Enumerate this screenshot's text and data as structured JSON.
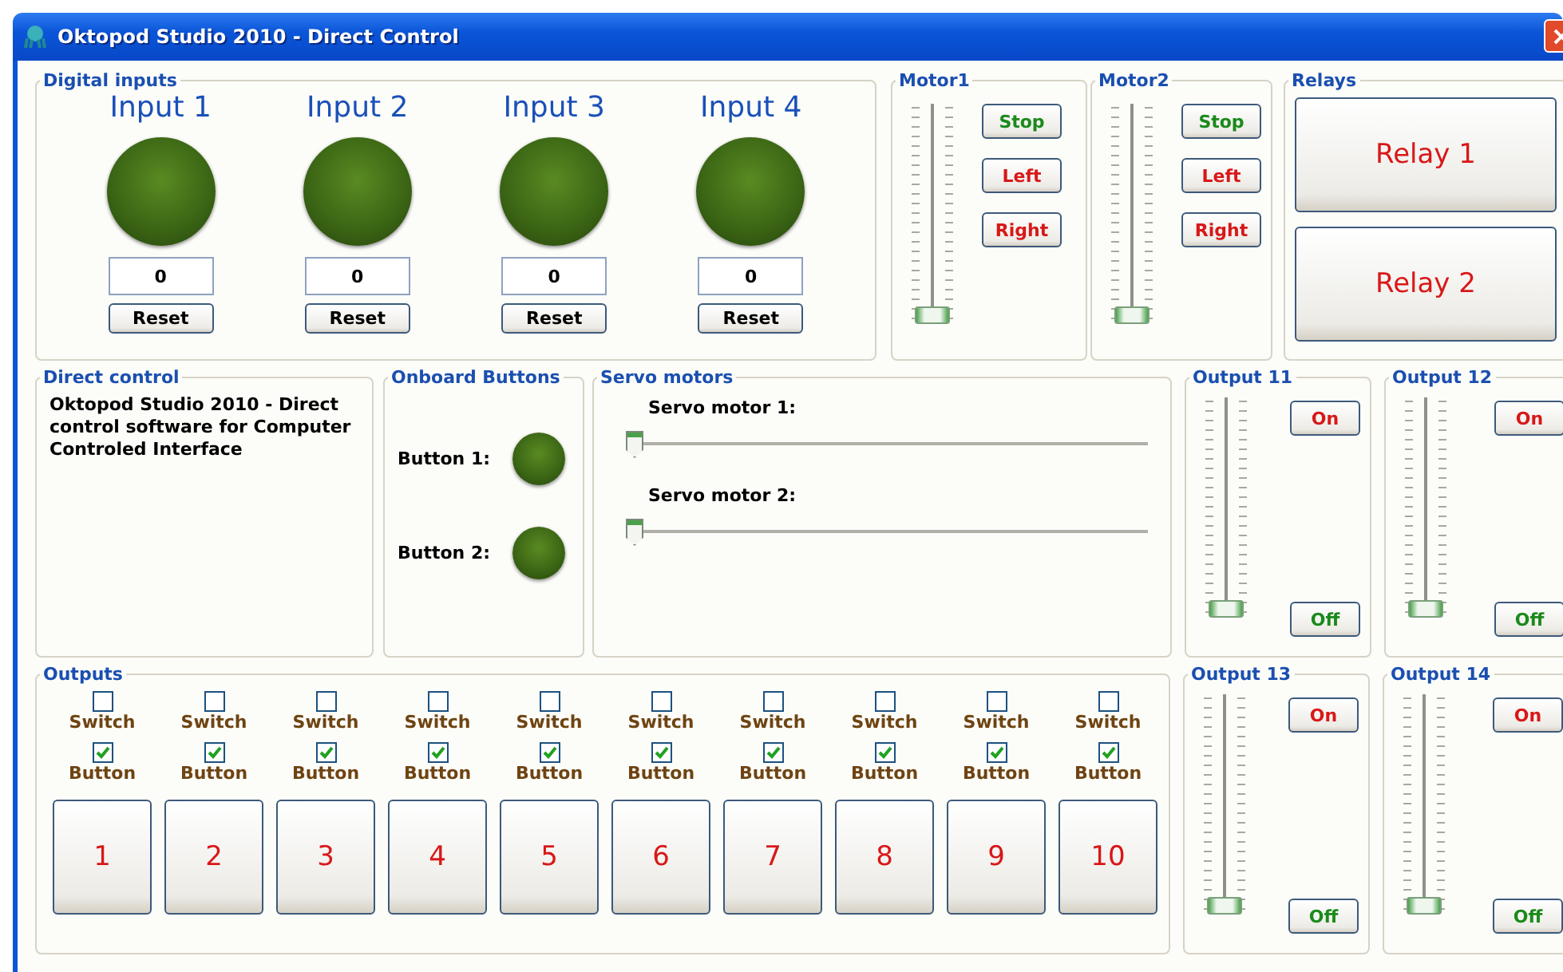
{
  "window": {
    "title": "Oktopod Studio 2010 - Direct Control"
  },
  "digital_inputs": {
    "title": "Digital inputs",
    "inputs": [
      {
        "label": "Input 1",
        "count": "0",
        "reset": "Reset"
      },
      {
        "label": "Input 2",
        "count": "0",
        "reset": "Reset"
      },
      {
        "label": "Input 3",
        "count": "0",
        "reset": "Reset"
      },
      {
        "label": "Input 4",
        "count": "0",
        "reset": "Reset"
      }
    ]
  },
  "motors": [
    {
      "title": "Motor1",
      "level": 0,
      "buttons": [
        {
          "label": "Stop",
          "kind": "stop"
        },
        {
          "label": "Left",
          "kind": "move"
        },
        {
          "label": "Right",
          "kind": "move"
        }
      ]
    },
    {
      "title": "Motor2",
      "level": 0,
      "buttons": [
        {
          "label": "Stop",
          "kind": "stop"
        },
        {
          "label": "Left",
          "kind": "move"
        },
        {
          "label": "Right",
          "kind": "move"
        }
      ]
    }
  ],
  "relays": {
    "title": "Relays",
    "buttons": [
      "Relay 1",
      "Relay 2"
    ]
  },
  "direct_control": {
    "title": "Direct control",
    "text": "Oktopod Studio 2010 - Direct control software for Computer Controled Interface"
  },
  "onboard_buttons": {
    "title": "Onboard Buttons",
    "buttons": [
      "Button 1:",
      "Button 2:"
    ]
  },
  "servos": {
    "title": "Servo motors",
    "motors": [
      {
        "label": "Servo motor 1:",
        "level": 0
      },
      {
        "label": "Servo motor 2:",
        "level": 0
      }
    ]
  },
  "outputs": {
    "title": "Outputs",
    "channels": [
      {
        "switch_label": "Switch",
        "switch_checked": false,
        "button_label": "Button",
        "button_checked": true,
        "number": "1"
      },
      {
        "switch_label": "Switch",
        "switch_checked": false,
        "button_label": "Button",
        "button_checked": true,
        "number": "2"
      },
      {
        "switch_label": "Switch",
        "switch_checked": false,
        "button_label": "Button",
        "button_checked": true,
        "number": "3"
      },
      {
        "switch_label": "Switch",
        "switch_checked": false,
        "button_label": "Button",
        "button_checked": true,
        "number": "4"
      },
      {
        "switch_label": "Switch",
        "switch_checked": false,
        "button_label": "Button",
        "button_checked": true,
        "number": "5"
      },
      {
        "switch_label": "Switch",
        "switch_checked": false,
        "button_label": "Button",
        "button_checked": true,
        "number": "6"
      },
      {
        "switch_label": "Switch",
        "switch_checked": false,
        "button_label": "Button",
        "button_checked": true,
        "number": "7"
      },
      {
        "switch_label": "Switch",
        "switch_checked": false,
        "button_label": "Button",
        "button_checked": true,
        "number": "8"
      },
      {
        "switch_label": "Switch",
        "switch_checked": false,
        "button_label": "Button",
        "button_checked": true,
        "number": "9"
      },
      {
        "switch_label": "Switch",
        "switch_checked": false,
        "button_label": "Button",
        "button_checked": true,
        "number": "10"
      }
    ]
  },
  "output_sliders": [
    {
      "title": "Output 11",
      "level": 0,
      "on": "On",
      "off": "Off"
    },
    {
      "title": "Output 12",
      "level": 0,
      "on": "On",
      "off": "Off"
    },
    {
      "title": "Output 13",
      "level": 0,
      "on": "On",
      "off": "Off"
    },
    {
      "title": "Output 14",
      "level": 0,
      "on": "On",
      "off": "Off"
    }
  ]
}
